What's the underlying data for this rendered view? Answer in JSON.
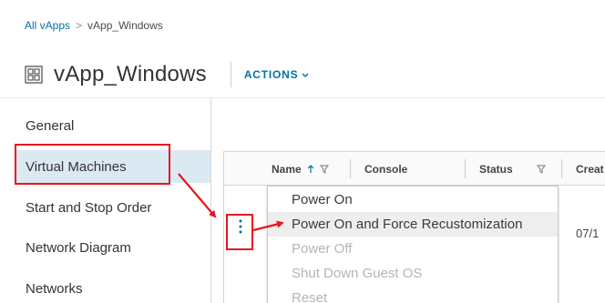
{
  "breadcrumb": {
    "parent": "All vApps",
    "separator": ">",
    "current": "vApp_Windows"
  },
  "header": {
    "title": "vApp_Windows",
    "actions_label": "ACTIONS"
  },
  "sidebar": {
    "items": [
      {
        "label": "General",
        "active": false
      },
      {
        "label": "Virtual Machines",
        "active": true
      },
      {
        "label": "Start and Stop Order",
        "active": false
      },
      {
        "label": "Network Diagram",
        "active": false
      },
      {
        "label": "Networks",
        "active": false
      }
    ]
  },
  "grid": {
    "columns": [
      {
        "label": "Name",
        "sort": "ascending",
        "filter": true
      },
      {
        "label": "Console",
        "filter": false
      },
      {
        "label": "Status",
        "filter": true
      },
      {
        "label": "Creat",
        "filter": false
      }
    ],
    "row": {
      "created": "07/1"
    }
  },
  "context_menu": {
    "items": [
      {
        "label": "Power On",
        "enabled": true,
        "hover": false
      },
      {
        "label": "Power On and Force Recustomization",
        "enabled": true,
        "hover": true
      },
      {
        "label": "Power Off",
        "enabled": false,
        "hover": false
      },
      {
        "label": "Shut Down Guest OS",
        "enabled": false,
        "hover": false
      },
      {
        "label": "Reset",
        "enabled": false,
        "hover": false
      }
    ]
  },
  "colors": {
    "link": "#0072a3",
    "active_bg": "#dbe9f3",
    "annotation_red": "#e8161d",
    "hover_bg": "#eeeeee",
    "disabled_text": "#b5b5b5"
  },
  "icons": {
    "vapp": "vapp-icon",
    "sort": "sort-up-icon",
    "filter": "filter-icon",
    "actions": "chevron-down-icon",
    "row_menu": "kebab-menu-icon"
  }
}
